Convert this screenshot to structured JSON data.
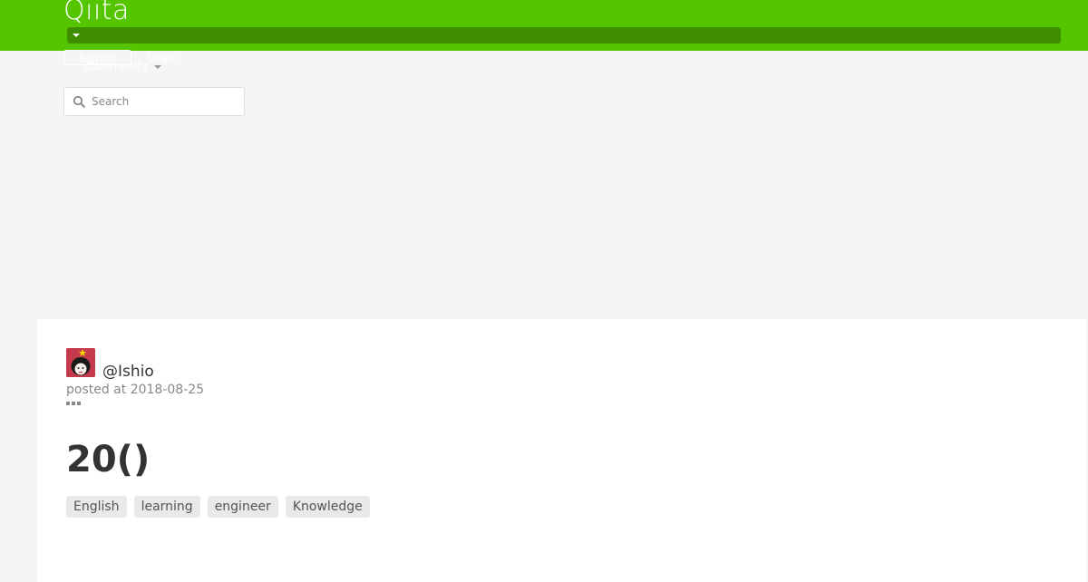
{
  "header": {
    "logo_text": "Qiita",
    "brand_color": "#55c500",
    "community_bar_color": "#3f8f00",
    "signup_label": "Signup",
    "login_label": "Login",
    "community_label": "Community",
    "search": {
      "placeholder": "Search",
      "value": ""
    }
  },
  "article": {
    "author": "@Ishio",
    "posted_at": "posted at 2018-08-25",
    "title": "20()",
    "tags": [
      "English",
      "learning",
      "engineer",
      "Knowledge"
    ]
  }
}
